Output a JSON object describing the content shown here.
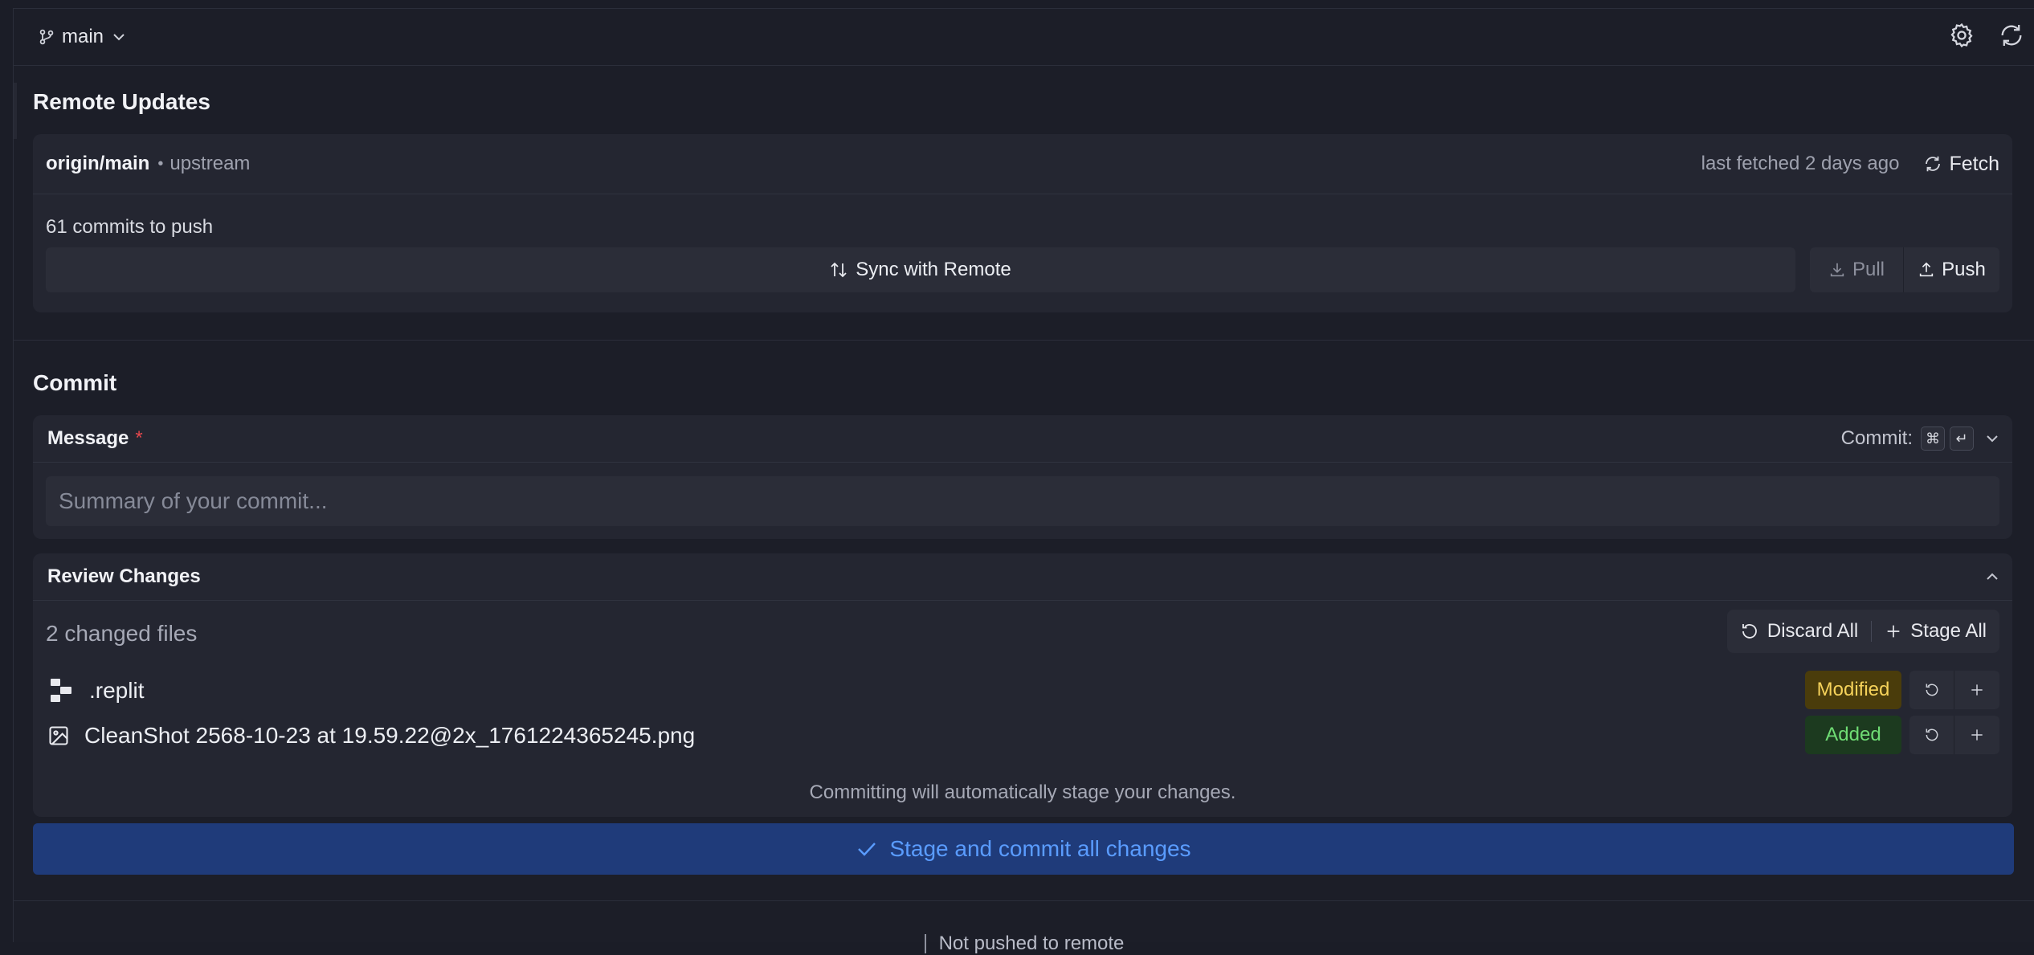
{
  "topbar": {
    "branch": "main",
    "icons": [
      "git-branch-icon",
      "chevron-down-icon",
      "gear-icon",
      "refresh-icon"
    ]
  },
  "remote": {
    "title": "Remote Updates",
    "branch": "origin/main",
    "separator": "•",
    "upstream": "upstream",
    "last_fetched": "last fetched 2 days ago",
    "fetch_label": "Fetch",
    "commits_to_push": "61 commits to push",
    "sync_label": "Sync with Remote",
    "pull_label": "Pull",
    "push_label": "Push"
  },
  "commit": {
    "title": "Commit",
    "message_label": "Message",
    "required_mark": "*",
    "shortcut_label": "Commit:",
    "shortcut_keys": [
      "⌘",
      "↵"
    ],
    "message_value": "",
    "message_placeholder": "Summary of your commit..."
  },
  "review": {
    "title": "Review Changes",
    "changed_count": "2 changed files",
    "discard_all": "Discard All",
    "stage_all": "Stage All",
    "files": [
      {
        "name": ".replit",
        "status": "Modified",
        "icon": "replit-icon"
      },
      {
        "name": "CleanShot 2568-10-23 at 19.59.22@2x_1761224365245.png",
        "status": "Added",
        "icon": "image-file-icon"
      }
    ],
    "note": "Committing will automatically stage your changes."
  },
  "commit_button": "Stage and commit all changes",
  "footer": {
    "status": "Not pushed to remote"
  },
  "colors": {
    "modified_bg": "#4a3c0b",
    "modified_text": "#f5d25a",
    "added_bg": "#1c3a1f",
    "added_text": "#6fdc74",
    "primary_bg": "#1f3b7a",
    "primary_text": "#5a9cff"
  }
}
